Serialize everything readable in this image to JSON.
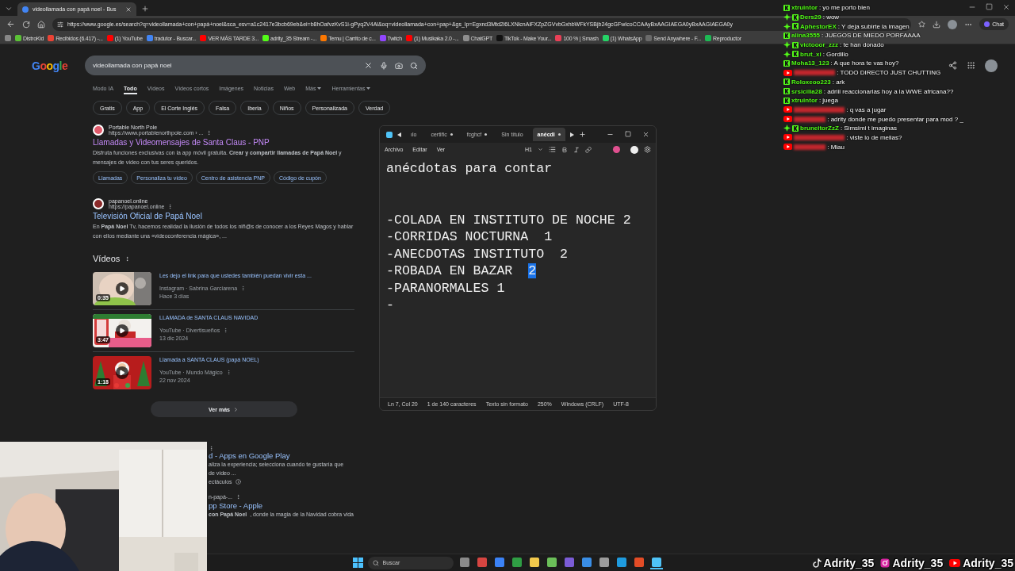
{
  "browser": {
    "tab": {
      "title": "videollamada con papá noel - Bus",
      "selected": true
    },
    "url": "https://www.google.es/search?q=videollamada+con+papá+noel&sca_esv=a1c2417e3bcb69eb&ei=b8hOafvzKvS1i-gPyq2V4Al&oq=videollamada+con+pap+&gs_lp=Egxnd3Mtd2l6LXNlcnAiFXZpZGVvbGxhbWFkYSBjb24gcGFwIcoCCAAyBxAAGIAEGA0yBxAAGIAEGA0y",
    "chat_button": "Chat",
    "bookmarks": [
      {
        "label": "DistroKid",
        "color": "#5bc236"
      },
      {
        "label": "Recibidos (6.417) -...",
        "color": "#ea4335"
      },
      {
        "label": "(1) YouTube",
        "color": "#ff0000"
      },
      {
        "label": "tradutor - Buscar...",
        "color": "#4285f4"
      },
      {
        "label": "VER MÁS TARDE 3...",
        "color": "#ff0000"
      },
      {
        "label": "adrity_35 Stream -...",
        "color": "#53fc18"
      },
      {
        "label": "Temu | Carrito de c...",
        "color": "#fb7701"
      },
      {
        "label": "Twitch",
        "color": "#9146ff"
      },
      {
        "label": "(1) Musikaka 2.0 -...",
        "color": "#ff0000"
      },
      {
        "label": "ChatGPT",
        "color": "#8e8e8e"
      },
      {
        "label": "TikTok - Make Your...",
        "color": "#111111"
      },
      {
        "label": "100 % | Smash",
        "color": "#e84057"
      },
      {
        "label": "(1) WhatsApp",
        "color": "#25d366"
      },
      {
        "label": "Send Anywhere - F...",
        "color": "#6a6a6a"
      },
      {
        "label": "Reproductor",
        "color": "#1db954"
      }
    ]
  },
  "google": {
    "logo": "Google",
    "query": "videollamada con papá noel",
    "tabs": [
      {
        "label": "Modo IA",
        "selected": false
      },
      {
        "label": "Todo",
        "selected": true
      },
      {
        "label": "Vídeos",
        "selected": false
      },
      {
        "label": "Vídeos cortos",
        "selected": false
      },
      {
        "label": "Imágenes",
        "selected": false
      },
      {
        "label": "Noticias",
        "selected": false
      },
      {
        "label": "Web",
        "selected": false
      },
      {
        "label": "Más",
        "selected": false,
        "dropdown": true
      },
      {
        "label": "Herramientas",
        "selected": false,
        "dropdown": true
      }
    ],
    "chips": [
      "Gratis",
      "App",
      "El Corte Inglés",
      "Falsa",
      "Iberia",
      "Niños",
      "Personalizada",
      "Verdad"
    ],
    "results": [
      {
        "site": "Portable North Pole",
        "url": "https://www.portablenorthpole.com › ...",
        "title": "Llamadas y Videomensajes de Santa Claus - PNP",
        "visited": true,
        "snippet": "Disfruta funciones exclusivas con la app móvil gratuita. **Crear y compartir llamadas de Papá Noel** y mensajes de vídeo con tus seres queridos.",
        "sitelinks": [
          "Llamadas",
          "Personaliza tu vídeo",
          "Centro de asistencia PNP",
          "Código de cupón"
        ]
      },
      {
        "site": "papanoel.online",
        "url": "https://papanoel.online",
        "title": "Televisión Oficial de Papá Noel",
        "visited": false,
        "snippet": "En **Papá Noel** Tv, hacemos realidad la ilusión de todos los niñ@s de conocer a los Reyes Magos y hablar con ellos mediante una «videoconferencia mágica», ..."
      }
    ],
    "videos_heading": "Vídeos",
    "videos": [
      {
        "title": "Les dejo el link para que ustedes también puedan vivir esta ...",
        "source": "Instagram · Sabrina Garciarena",
        "date": "Hace 3 días",
        "duration": "0:35"
      },
      {
        "title": "LLAMADA de SANTA CLAUS NAVIDAD",
        "source": "YouTube · Divertisueños",
        "date": "13 dic 2024",
        "duration": "3:47"
      },
      {
        "title": "Llamada a SANTA CLAUS (papá NOEL)",
        "source": "YouTube · Mundo Mágico",
        "date": "22 nov 2024",
        "duration": "1:18"
      }
    ],
    "more_button": "Ver más",
    "partial_results": [
      {
        "title": "d - Apps en Google Play",
        "snippet": "aliza la experiencia; selecciona cuando te gustaría que",
        "snippet_2": "de vídeo ...",
        "note": "ectáculos"
      },
      {
        "url": "n-papá-...",
        "title": "pp Store - Apple",
        "snippet": "**con Papá Noel**, donde la magia de la Navidad cobra vida"
      }
    ]
  },
  "notepad": {
    "tabs": [
      {
        "label": "ılo",
        "selected": false,
        "unsaved": false
      },
      {
        "label": "certific",
        "selected": false,
        "unsaved": true
      },
      {
        "label": "fcghcf",
        "selected": false,
        "unsaved": true
      },
      {
        "label": "Sin título",
        "selected": false,
        "unsaved": false
      },
      {
        "label": "anécdi",
        "selected": true,
        "unsaved": true
      }
    ],
    "menu": [
      "Archivo",
      "Editar",
      "Ver"
    ],
    "heading": "H1",
    "lines": [
      {
        "text": "anécdotas para contar"
      },
      {
        "text": "-COLADA EN INSTITUTO DE NOCHE 2"
      },
      {
        "text": "-CORRIDAS NOCTURNA  1"
      },
      {
        "text": "-ANECDOTAS INSTITUTO  2"
      },
      {
        "text": "-ROBADA EN BAZAR  ",
        "selection": "2"
      },
      {
        "text": "-PARANORMALES 1"
      },
      {
        "text": "-"
      }
    ],
    "status": [
      "Ln 7, Col 20",
      "1 de 140 caracteres",
      "Texto sin formato",
      "250%",
      "Windows (CRLF)",
      "UTF-8"
    ]
  },
  "chat": [
    {
      "kind": "kick",
      "badge": false,
      "user": "xtruintor",
      "text": ": yo me porto bien"
    },
    {
      "kind": "kick",
      "badge": true,
      "user": "Ders29",
      "text": ": wow"
    },
    {
      "kind": "kick",
      "badge": true,
      "user": "AphestorEX",
      "text": ": Y deja subirte la imagen"
    },
    {
      "kind": "kick",
      "badge": false,
      "user": "alina3555",
      "text": ": JUEGOS DE MIEDO PORFAAAA"
    },
    {
      "kind": "kick",
      "badge": true,
      "user": "victooor_zzz",
      "text": ": te han donado"
    },
    {
      "kind": "kick",
      "badge": true,
      "user": "brut_xi",
      "text": ": Gordillo"
    },
    {
      "kind": "kick",
      "badge": false,
      "user": "Moha13_123",
      "text": ": A que hora te vas hoy?"
    },
    {
      "kind": "youtube",
      "badge": false,
      "text": ": TODO DIRECTO JUST CHUTTING"
    },
    {
      "kind": "kick",
      "badge": false,
      "user": "Roloxeoo223",
      "text": ": ark"
    },
    {
      "kind": "kick",
      "badge": false,
      "user": "srsicilia28",
      "text": ": adriii reaccionarias hoy a la WWE africana??"
    },
    {
      "kind": "kick",
      "badge": false,
      "user": "xtruintor",
      "text": ": juega"
    },
    {
      "kind": "youtube",
      "badge": false,
      "text": ": q vas a jugar"
    },
    {
      "kind": "youtube",
      "badge": false,
      "text": ": adrity donde me puedo presentar para mod ? _"
    },
    {
      "kind": "kick",
      "badge": true,
      "user": "bruneitorZzZ",
      "text": ": Simsimi t imaginas"
    },
    {
      "kind": "youtube",
      "badge": false,
      "text": ": viste lo de melias?"
    },
    {
      "kind": "youtube",
      "badge": false,
      "text": ": Miau"
    }
  ],
  "taskbar": {
    "search": "Buscar",
    "apps": [
      {
        "color": "#8a8a8a",
        "selected": false
      },
      {
        "color": "#d64541",
        "selected": false
      },
      {
        "color": "#3b82f6",
        "selected": false
      },
      {
        "color": "#2f9e44",
        "selected": false
      },
      {
        "color": "#f2c94c",
        "selected": false
      },
      {
        "color": "#6bbf59",
        "selected": false
      },
      {
        "color": "#7b5cd6",
        "selected": false
      },
      {
        "color": "#3a8ee6",
        "selected": false
      },
      {
        "color": "#9b9b9b",
        "selected": false
      },
      {
        "color": "#1f9bde",
        "selected": false
      },
      {
        "color": "#e34c26",
        "selected": false
      },
      {
        "color": "#4fc3f7",
        "selected": true
      }
    ]
  },
  "socials": [
    {
      "kind": "tiktok",
      "handle": "Adrity_35"
    },
    {
      "kind": "instagram",
      "handle": "Adrity_35"
    },
    {
      "kind": "youtube",
      "handle": "Adrity_35"
    }
  ]
}
